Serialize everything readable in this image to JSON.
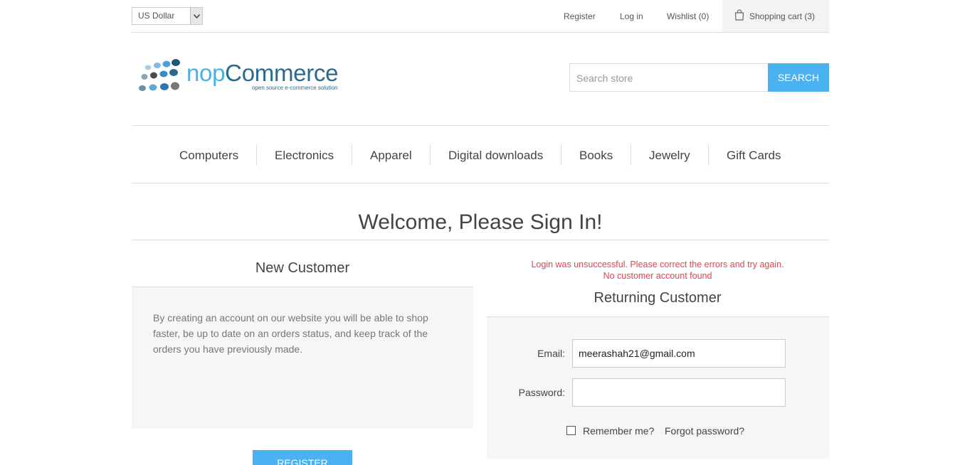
{
  "header": {
    "currency": "US Dollar",
    "links": {
      "register": "Register",
      "login": "Log in",
      "wishlist": "Wishlist (0)",
      "cart": "Shopping cart (3)"
    }
  },
  "logo": {
    "prefix": "nop",
    "main": "Commerce",
    "tagline": "open source e-commerce solution"
  },
  "search": {
    "placeholder": "Search store",
    "button": "SEARCH"
  },
  "menu": {
    "items": [
      "Computers",
      "Electronics",
      "Apparel",
      "Digital downloads",
      "Books",
      "Jewelry",
      "Gift Cards"
    ]
  },
  "page": {
    "title": "Welcome, Please Sign In!"
  },
  "new_customer": {
    "heading": "New Customer",
    "text": "By creating an account on our website you will be able to shop faster, be up to date on an orders status, and keep track of the orders you have previously made.",
    "register_button": "REGISTER"
  },
  "returning_customer": {
    "error_line1": "Login was unsuccessful. Please correct the errors and try again.",
    "error_line2": "No customer account found",
    "heading": "Returning Customer",
    "email_label": "Email:",
    "email_value": "meerashah21@gmail.com",
    "password_label": "Password:",
    "password_value": "",
    "remember_label": "Remember me?",
    "forgot_label": "Forgot password?"
  },
  "colors": {
    "accent": "#4ab2f1",
    "error": "#e4434b",
    "logo_blue": "#2a6a8e"
  }
}
